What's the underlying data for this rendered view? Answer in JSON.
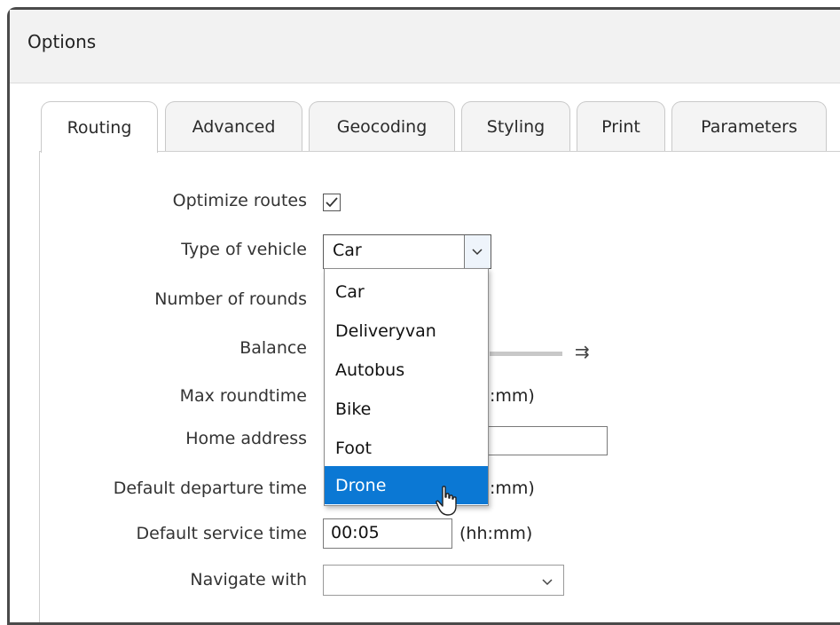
{
  "window": {
    "title": "Options"
  },
  "tabs": [
    "Routing",
    "Advanced",
    "Geocoding",
    "Styling",
    "Print",
    "Parameters"
  ],
  "active_tab": "Routing",
  "form": {
    "optimize_routes": {
      "label": "Optimize routes",
      "checked": true
    },
    "vehicle": {
      "label": "Type of vehicle",
      "value": "Car"
    },
    "rounds": {
      "label": "Number of rounds"
    },
    "balance": {
      "label": "Balance",
      "icon": "swap-arrows-icon",
      "glyph": "⇉"
    },
    "max_roundtime": {
      "label": "Max roundtime",
      "unit_fragment": ":mm)"
    },
    "home_address": {
      "label": "Home address",
      "value": ""
    },
    "default_departure": {
      "label": "Default departure time",
      "unit_fragment": ":mm)"
    },
    "default_service": {
      "label": "Default service time",
      "value": "00:05",
      "unit": "(hh:mm)"
    },
    "navigate_with": {
      "label": "Navigate with",
      "value": ""
    }
  },
  "vehicle_dropdown": {
    "options": [
      "Car",
      "Deliveryvan",
      "Autobus",
      "Bike",
      "Foot",
      "Drone"
    ],
    "highlighted": "Drone"
  },
  "colors": {
    "selection": "#0b78d4",
    "titlebar": "#f2f2f2"
  }
}
